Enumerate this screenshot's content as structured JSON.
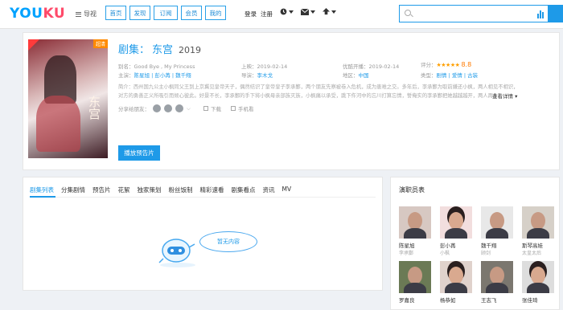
{
  "header": {
    "logo_left": "YOU",
    "logo_right": "KU",
    "guide_label": "导视",
    "nav_tabs": [
      "首页",
      "发现",
      "订阅",
      "会员",
      "我的"
    ],
    "login_label": "登录",
    "register_label": "注册",
    "tool_icons": [
      "history-icon",
      "mail-icon",
      "upload-icon"
    ],
    "search_placeholder": ""
  },
  "show": {
    "category": "剧集：",
    "name": "东宫",
    "year": "2019",
    "poster_badge": "超清",
    "poster_title": "东宫",
    "alias_label": "别名：",
    "alias_value": "Good Bye , My Princess",
    "release_label": "上映：",
    "release_value": "2019-02-14",
    "youku_label": "优酷开播：",
    "youku_value": "2019-02-14",
    "rating_label": "评分：",
    "rating_stars": "★★★★★",
    "rating_value": "8.8",
    "cast_label": "主演：",
    "cast_value": "陈星旭 | 彭小苒 | 魏千翔",
    "director_label": "导演：",
    "director_value": "李木戈",
    "region_label": "地区：",
    "region_value": "中国",
    "genre_label": "类型：",
    "genre_value": "剧情 | 爱情 | 古装",
    "desc_line1": "简介：西州国九公主小枫同父王到上京冀见皇帝天子，偶然结识了皇帝皇子李承鄞，两个朋友先察被卷入危机，成为患难之交。多年后，李承鄞为取前嫌还小枫，两人相见不相识，但还是被",
    "desc_line2": "对方的勇善正义所吸引而倾心彼此。好景不长，李承鄞的手下将小枫母亲部族灭族，小枫痛以承受，跳下仵河中的忘川打算忘情，誓俺实的李承鄞把她越越越开，两人再见时…",
    "more_label": "查看详情",
    "share_label": "分享给朋友：",
    "download_label": "下载",
    "phone_label": "手机看",
    "play_label": "播放预告片"
  },
  "episodes": {
    "tabs": [
      "剧集列表",
      "分集剧情",
      "预告片",
      "花絮",
      "独家策划",
      "粉丝饭制",
      "精彩速看",
      "剧集看点",
      "资讯",
      "MV"
    ],
    "empty_text": "暂无内容"
  },
  "cast_panel": {
    "title": "演职员表",
    "actors": [
      {
        "name": "陈星旭",
        "role": "李承鄞"
      },
      {
        "name": "彭小苒",
        "role": "小枫"
      },
      {
        "name": "魏千翔",
        "role": "顾剑"
      },
      {
        "name": "斯琴高娃",
        "role": "太皇太后"
      },
      {
        "name": "罗嘉良",
        "role": ""
      },
      {
        "name": "杨恭如",
        "role": ""
      },
      {
        "name": "王志飞",
        "role": ""
      },
      {
        "name": "张佳琦",
        "role": ""
      }
    ]
  },
  "colors": {
    "accent": "#1e9ae8",
    "logo_red": "#ff4a6a",
    "score": "#ff7a00"
  }
}
